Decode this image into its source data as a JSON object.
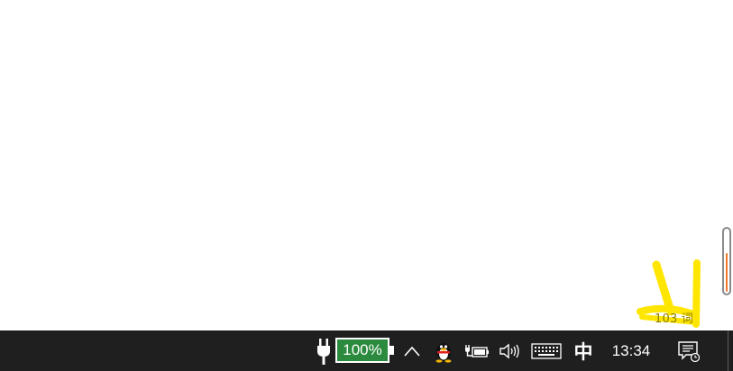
{
  "taskbar": {
    "battery_percent": "100%",
    "battery_level": 1.0,
    "clock": "13:34",
    "ime_mode": "中",
    "icons": {
      "power": "power-plug-icon",
      "overflow": "chevron-up-icon",
      "qq": "qq-penguin-icon",
      "battery_status": "battery-charging-icon",
      "volume": "speaker-icon",
      "keyboard": "touch-keyboard-icon",
      "notifications": "action-center-icon"
    }
  },
  "overlay": {
    "word_count": "103 词",
    "gauge_level": 0.65,
    "highlight_color": "#ffe600",
    "gauge_color": "#f07a2a"
  },
  "colors": {
    "taskbar_bg": "#1f1f1f",
    "battery_fill": "#2c8a3f"
  }
}
